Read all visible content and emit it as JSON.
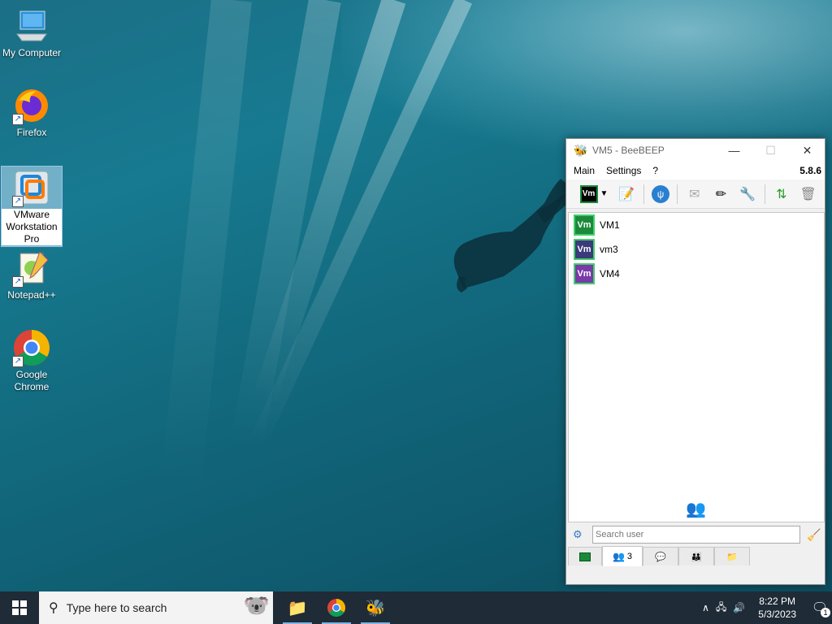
{
  "desktop": {
    "icons": [
      {
        "label": "My Computer",
        "icon": "computer-icon"
      },
      {
        "label": "Firefox",
        "icon": "firefox-icon"
      },
      {
        "label": "VMware Workstation Pro",
        "icon": "vmware-icon"
      },
      {
        "label": "Notepad++",
        "icon": "notepadpp-icon"
      },
      {
        "label": "Google Chrome",
        "icon": "chrome-icon"
      }
    ]
  },
  "beebeep": {
    "title": "VM5 - BeeBEEP",
    "version": "5.8.6",
    "menu": [
      "Main",
      "Settings",
      "?"
    ],
    "users": [
      {
        "name": "VM1",
        "badge": "Vm",
        "color": "#1a8a3a"
      },
      {
        "name": "vm3",
        "badge": "Vm",
        "color": "#3b3a7a"
      },
      {
        "name": "VM4",
        "badge": "Vm",
        "color": "#7a3aa8"
      }
    ],
    "toolbar_status": "Vm",
    "search_placeholder": "Search user",
    "tabs": [
      {
        "icon": "status-icon",
        "label": ""
      },
      {
        "icon": "users-icon",
        "label": "3"
      },
      {
        "icon": "chat-icon",
        "label": ""
      },
      {
        "icon": "groups-icon",
        "label": ""
      },
      {
        "icon": "files-icon",
        "label": ""
      }
    ]
  },
  "taskbar": {
    "search_text": "Type here to search",
    "time": "8:22 PM",
    "date": "5/3/2023",
    "notifications": "1"
  }
}
